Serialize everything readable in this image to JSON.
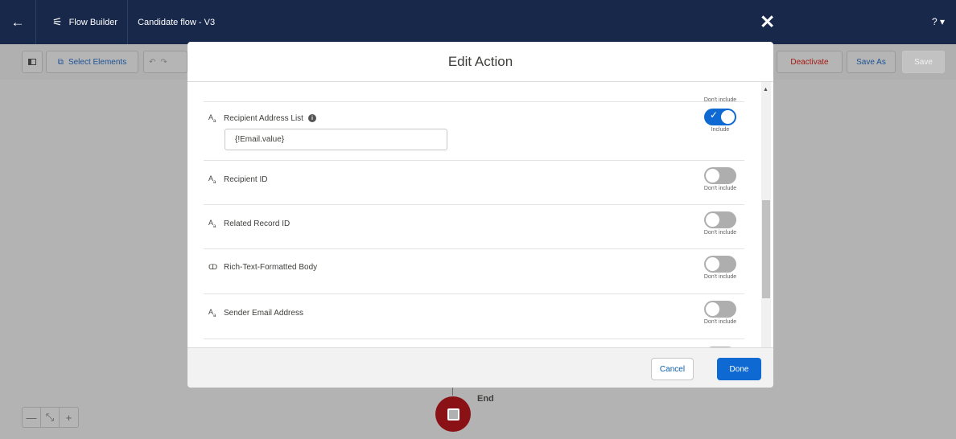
{
  "header": {
    "back_icon": "arrow-left-icon",
    "app_icon": "flow-icon",
    "app_name": "Flow Builder",
    "flow_name": "Candidate flow - V3",
    "help": "? ▾"
  },
  "toolbar": {
    "select_elements": "Select Elements",
    "deactivate": "Deactivate",
    "save_as": "Save As",
    "save": "Save"
  },
  "modal": {
    "title": "Edit Action",
    "close_icon": "close-icon",
    "rows": [
      {
        "label": "",
        "toggle_text": "Don't include",
        "on": false
      },
      {
        "label": "Recipient Address List",
        "value": "{!Email.value}",
        "toggle_text": "Include",
        "on": true,
        "type_icon": "text-type-icon"
      },
      {
        "label": "Recipient ID",
        "toggle_text": "Don't include",
        "on": false,
        "type_icon": "text-type-icon"
      },
      {
        "label": "Related Record ID",
        "toggle_text": "Don't include",
        "on": false,
        "type_icon": "text-type-icon"
      },
      {
        "label": "Rich-Text-Formatted Body",
        "toggle_text": "Don't include",
        "on": false,
        "type_icon": "rich-text-type-icon"
      },
      {
        "label": "Sender Email Address",
        "toggle_text": "Don't include",
        "on": false,
        "type_icon": "text-type-icon"
      }
    ],
    "cancel": "Cancel",
    "done": "Done"
  },
  "canvas": {
    "end_label": "End"
  },
  "colors": {
    "header_bg": "#18284a",
    "brand_blue": "#0e6ad2",
    "end_node": "#8a1217",
    "deactivate_red": "#a61a14"
  }
}
